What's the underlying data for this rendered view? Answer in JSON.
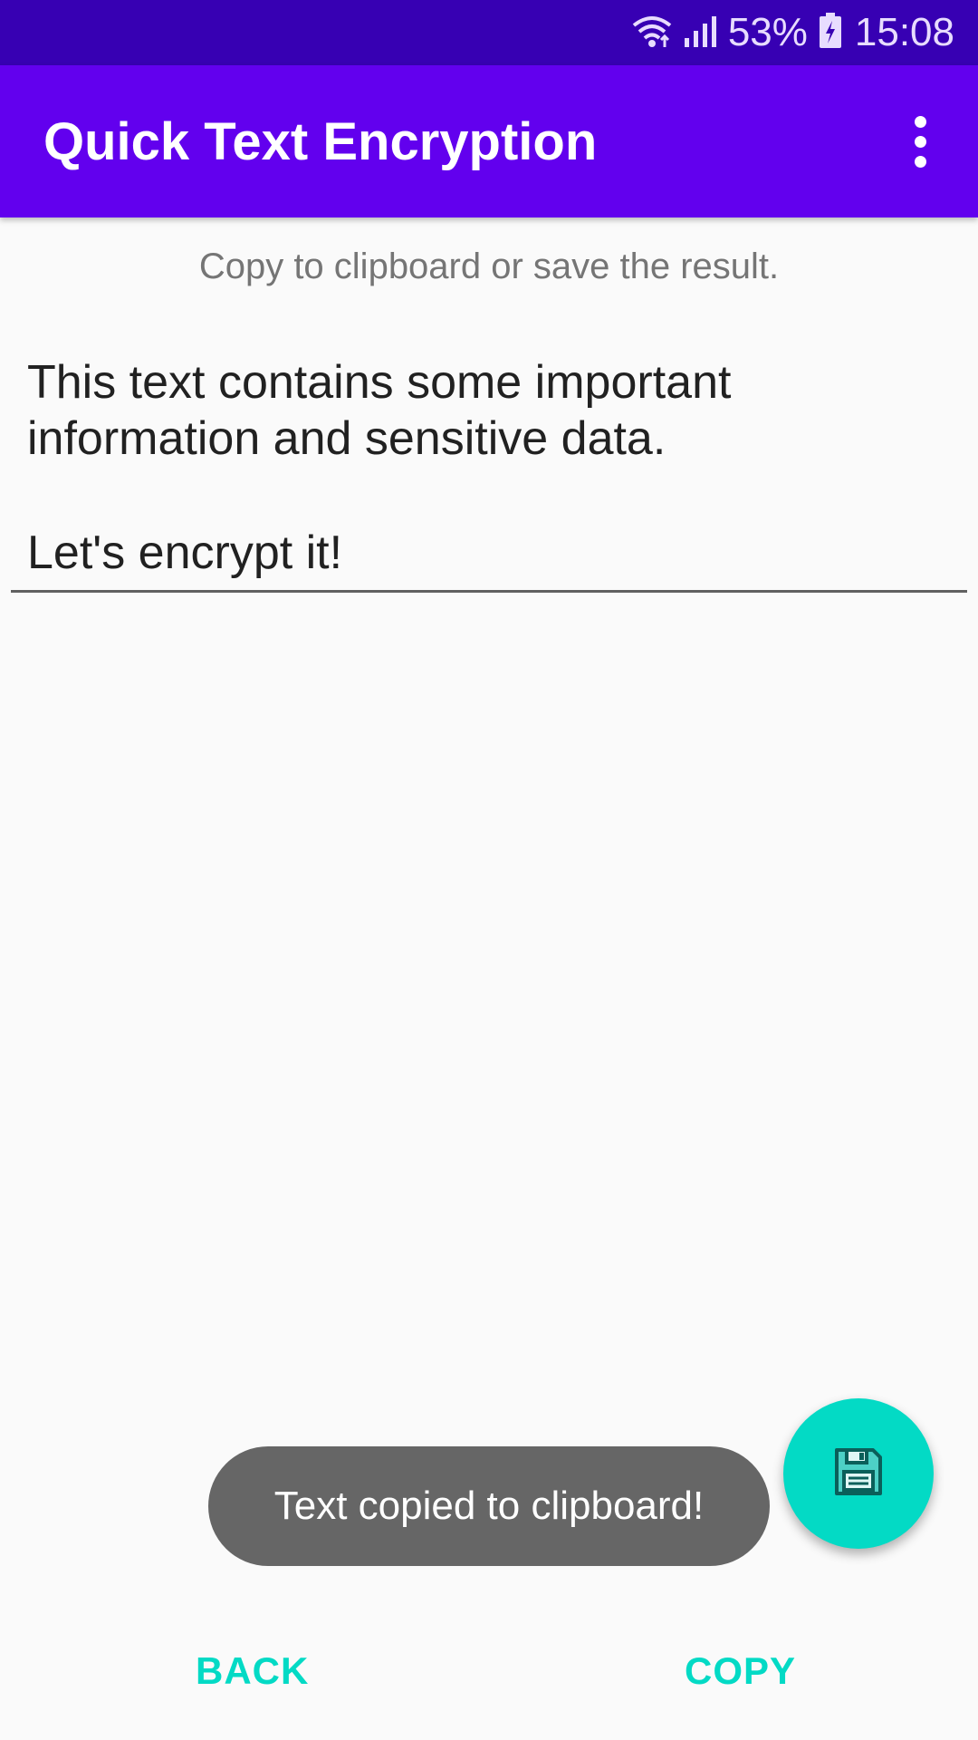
{
  "status_bar": {
    "battery_percent": "53%",
    "time": "15:08",
    "icons": [
      "wifi-icon",
      "signal-icon",
      "battery-icon"
    ]
  },
  "app_bar": {
    "title": "Quick Text Encryption",
    "menu_icon": "overflow-menu-icon"
  },
  "main": {
    "instruction": "Copy to clipboard or save the result.",
    "result_text_lines": [
      "This text contains some important",
      "information and sensitive data.",
      "Let's encrypt it!"
    ]
  },
  "toast": {
    "message": "Text copied to clipboard!"
  },
  "fab": {
    "icon": "save-icon"
  },
  "bottom_actions": {
    "back_label": "BACK",
    "copy_label": "COPY"
  },
  "colors": {
    "status_bar": "#3700b3",
    "primary": "#6200ee",
    "accent": "#03dac5",
    "toast_bg": "#666666"
  }
}
